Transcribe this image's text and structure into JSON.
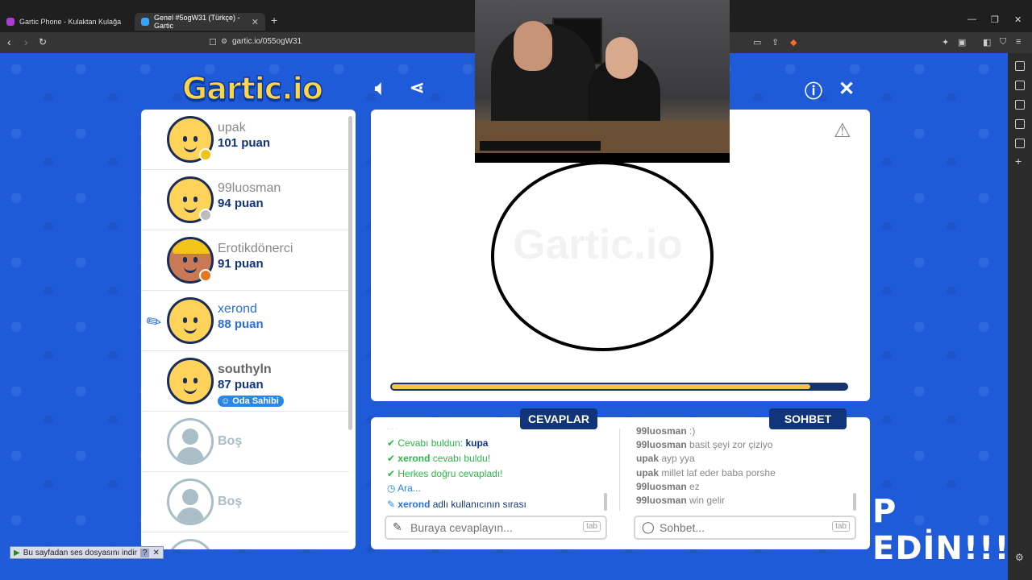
{
  "browser": {
    "tabs": [
      {
        "title": "Gartic Phone - Kulaktan Kulağa"
      },
      {
        "title": "Genel #5ogW31 (Türkçe) - Gartic"
      }
    ],
    "url": "gartic.io/055ogW31"
  },
  "game": {
    "logo": "Gartic.io",
    "players": [
      {
        "name": "upak",
        "score": "101 puan",
        "medal": "#f2c31a"
      },
      {
        "name": "99luosman",
        "score": "94 puan",
        "medal": "#bdbdbd"
      },
      {
        "name": "Erotikdönerci",
        "score": "91 puan",
        "medal": "#e07a22"
      },
      {
        "name": "xerond",
        "score": "88 puan"
      },
      {
        "name": "southyln",
        "score": "87 puan",
        "badge": "Oda Sahibi"
      },
      {
        "name": "Boş"
      },
      {
        "name": "Boş"
      }
    ],
    "progress": 0.92,
    "tabs": {
      "answers": "CEVAPLAR",
      "chat": "SOHBET"
    },
    "answers": [
      {
        "text": "Cevabı buldun: ",
        "bold": "kupa",
        "type": "green"
      },
      {
        "bold": "xerond",
        "text": " cevabı buldu!",
        "type": "green"
      },
      {
        "text": "Herkes doğru cevapladı!",
        "type": "green"
      },
      {
        "text": "Ara...",
        "type": "blue"
      },
      {
        "bold": "xerond",
        "text": " adlı kullanıcının sırası",
        "type": "blue"
      }
    ],
    "chat": [
      {
        "user": "99luosman",
        "text": " :)"
      },
      {
        "user": "99luosman",
        "text": " basit şeyi zor çiziyo"
      },
      {
        "user": "upak",
        "text": " ayp yya"
      },
      {
        "user": "upak",
        "text": " millet laf eder baba porshe"
      },
      {
        "user": "99luosman",
        "text": " ez"
      },
      {
        "user": "99luosman",
        "text": " win gelir"
      }
    ],
    "answer_placeholder": "Buraya cevaplayın...",
    "chat_placeholder": "Sohbet...",
    "tab_key": "tab"
  },
  "overlay": "P EDİN!!!",
  "audio_bar": "Bu sayfadan ses dosyasını indir"
}
